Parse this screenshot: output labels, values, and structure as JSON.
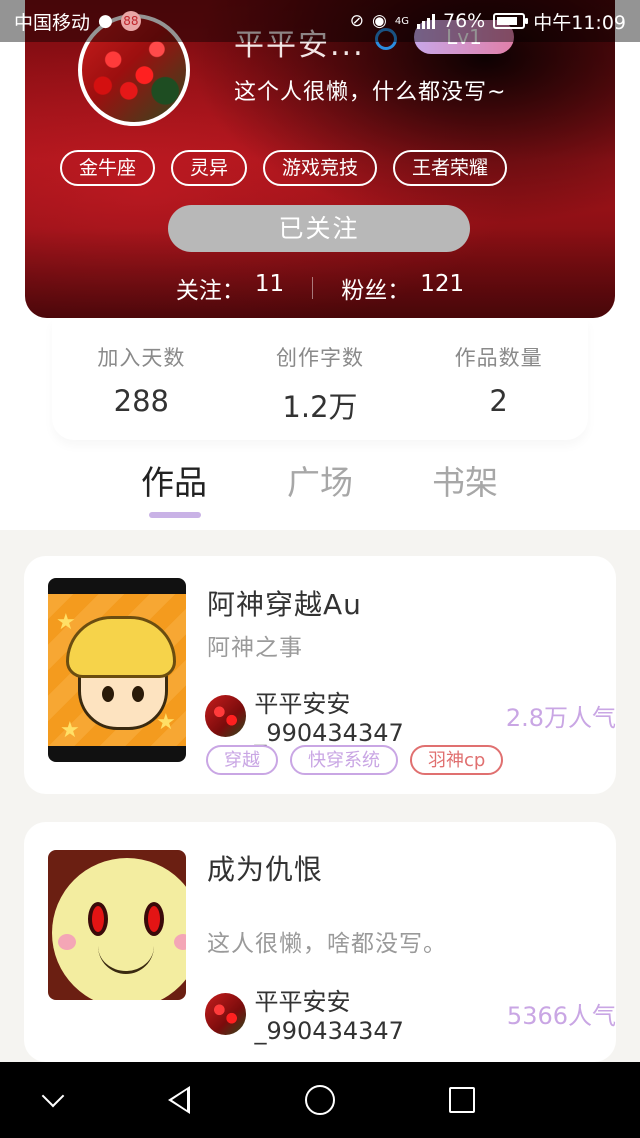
{
  "status_bar": {
    "carrier": "中国移动",
    "network": "4G",
    "battery": "76%",
    "time": "中午11:09",
    "badge_text": "88"
  },
  "profile": {
    "username": "平平安...",
    "level": "Lv1",
    "bio": "这个人很懒，什么都没写~",
    "tags": [
      "金牛座",
      "灵异",
      "游戏竞技",
      "王者荣耀"
    ],
    "follow_button": "已关注",
    "following_label": "关注：",
    "following_count": "11",
    "fans_label": "粉丝：",
    "fans_count": "121"
  },
  "stats": [
    {
      "label": "加入天数",
      "value": "288"
    },
    {
      "label": "创作字数",
      "value": "1.2万"
    },
    {
      "label": "作品数量",
      "value": "2"
    }
  ],
  "tabs": [
    {
      "label": "作品",
      "active": true
    },
    {
      "label": "广场",
      "active": false
    },
    {
      "label": "书架",
      "active": false
    }
  ],
  "works": [
    {
      "title": "阿神穿越Au",
      "subtitle": "阿神之事",
      "author": "平平安安_990434347",
      "popularity": "2.8万人气",
      "tags": [
        {
          "label": "穿越",
          "color": "#c9a6e4"
        },
        {
          "label": "快穿系统",
          "color": "#c9a6e4"
        },
        {
          "label": "羽神cp",
          "color": "#e07070"
        }
      ]
    },
    {
      "title": "成为仇恨",
      "subtitle": "这人很懒，啥都没写。",
      "author": "平平安安_990434347",
      "popularity": "5366人气",
      "tags": []
    }
  ],
  "colors": {
    "accent": "#c9b2e6",
    "popularity": "#c9a6e4",
    "header_red": "#a5141a"
  }
}
